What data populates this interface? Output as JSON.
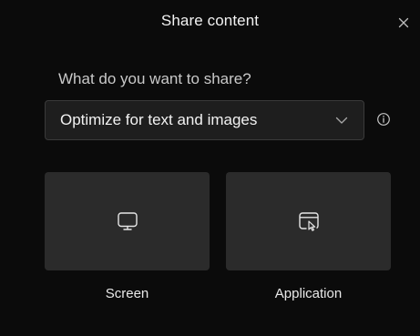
{
  "dialog": {
    "title": "Share content",
    "close_icon": "close-icon",
    "question": "What do you want to share?",
    "optimize_select": {
      "selected": "Optimize for text and images",
      "chevron_icon": "chevron-down-icon"
    },
    "info_icon": "info-icon",
    "options": [
      {
        "label": "Screen",
        "icon": "monitor-icon"
      },
      {
        "label": "Application",
        "icon": "application-window-icon"
      }
    ]
  },
  "colors": {
    "background": "#0b0b0b",
    "tile": "#2b2b2b",
    "select": "#1e1e1e",
    "text": "#f2f2f2"
  }
}
